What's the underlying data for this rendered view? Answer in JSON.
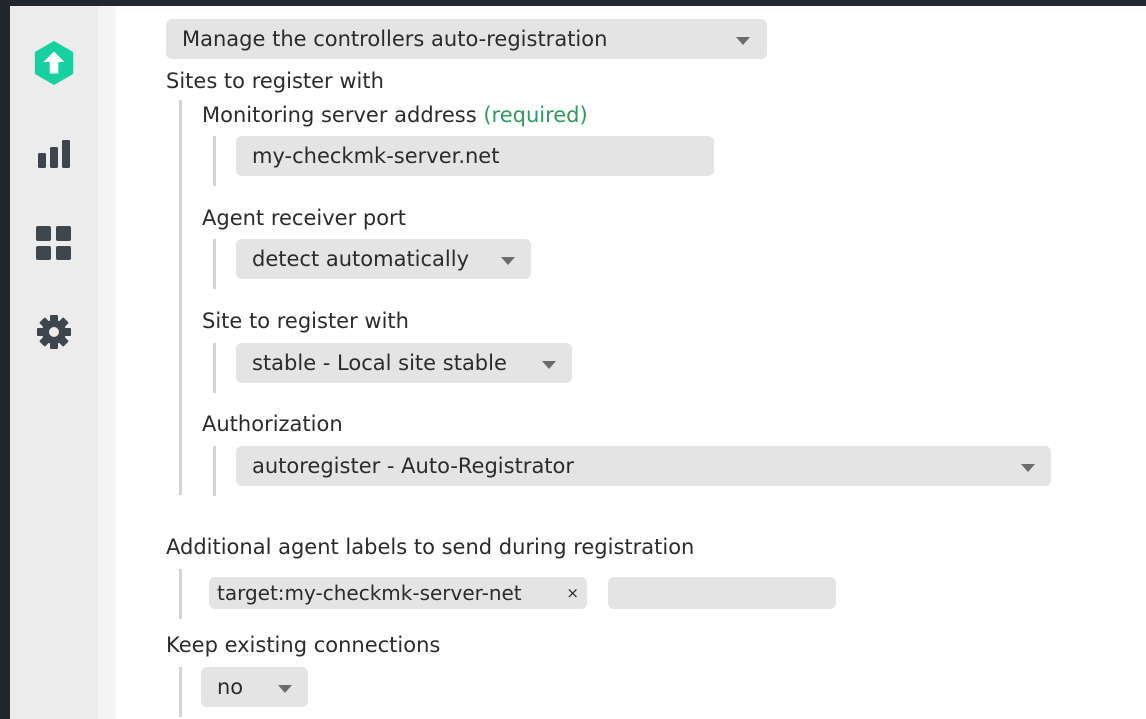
{
  "sidebar": {
    "items": [
      {
        "name": "logo",
        "icon": "checkmk-logo-icon"
      },
      {
        "name": "monitor",
        "icon": "bar-chart-icon"
      },
      {
        "name": "customize",
        "icon": "dashboard-grid-icon"
      },
      {
        "name": "setup",
        "icon": "gear-icon"
      }
    ],
    "accent": "#15d1a0"
  },
  "form": {
    "mode_select": {
      "value": "Manage the controllers auto-registration"
    },
    "sites_heading": "Sites to register with",
    "server_address": {
      "label": "Monitoring server address",
      "required": "(required)",
      "value": "my-checkmk-server.net"
    },
    "receiver_port": {
      "label": "Agent receiver port",
      "value": "detect automatically"
    },
    "site": {
      "label": "Site to register with",
      "value": "stable - Local site stable"
    },
    "authorization": {
      "label": "Authorization",
      "value": "autoregister - Auto-Registrator"
    },
    "labels": {
      "label": "Additional agent labels to send during registration",
      "tags": [
        "target:my-checkmk-server-net"
      ],
      "tag_remove": "×",
      "new_tag_value": ""
    },
    "keep_connections": {
      "label": "Keep existing connections",
      "value": "no"
    }
  },
  "colors": {
    "required": "#2d9b5e",
    "field_bg": "#e4e4e4"
  }
}
